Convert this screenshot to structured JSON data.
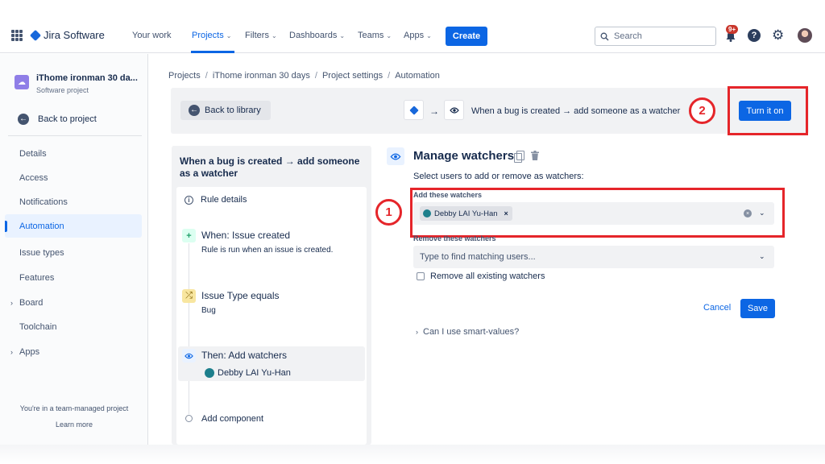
{
  "topnav": {
    "app_name": "Jira Software",
    "items": [
      {
        "label": "Your work"
      },
      {
        "label": "Projects"
      },
      {
        "label": "Filters"
      },
      {
        "label": "Dashboards"
      },
      {
        "label": "Teams"
      },
      {
        "label": "Apps"
      }
    ],
    "create_label": "Create",
    "search_placeholder": "Search",
    "notifications_badge": "9+",
    "help_glyph": "?",
    "icons": [
      "app-switcher-icon",
      "jira-logo-icon",
      "search-icon",
      "bell-icon",
      "help-icon",
      "gear-icon",
      "avatar"
    ]
  },
  "sidebar": {
    "project_name": "iThome ironman 30 da...",
    "project_type": "Software project",
    "back_label": "Back to project",
    "items": [
      {
        "label": "Details"
      },
      {
        "label": "Access"
      },
      {
        "label": "Notifications"
      },
      {
        "label": "Automation"
      },
      {
        "label": "Issue types"
      },
      {
        "label": "Features"
      },
      {
        "label": "Board"
      },
      {
        "label": "Toolchain"
      },
      {
        "label": "Apps"
      }
    ],
    "footer_text": "You're in a team-managed project",
    "learn_more": "Learn more"
  },
  "breadcrumb": [
    "Projects",
    "iThome ironman 30 days",
    "Project settings",
    "Automation"
  ],
  "header": {
    "back_label": "Back to library",
    "rule_summary": "When a bug is created → add someone as a watcher",
    "turn_on_label": "Turn it on"
  },
  "rule": {
    "title": "When a bug is created → add someone as a watcher",
    "details_label": "Rule details",
    "trigger_title": "When: Issue created",
    "trigger_sub": "Rule is run when an issue is created.",
    "condition_title": "Issue Type equals",
    "condition_sub": "Bug",
    "action_title": "Then: Add watchers",
    "action_user": "Debby LAI Yu-Han",
    "add_component": "Add component"
  },
  "config": {
    "title": "Manage watchers",
    "hint": "Select users to add or remove as watchers:",
    "add_label": "Add these watchers",
    "add_chip": "Debby LAI Yu-Han",
    "remove_label": "Remove these watchers",
    "remove_placeholder": "Type to find matching users...",
    "checkbox_label": "Remove all existing watchers",
    "cancel_label": "Cancel",
    "save_label": "Save",
    "smart_values": "Can I use smart-values?"
  },
  "annotations": {
    "one": "1",
    "two": "2",
    "color": "#e5252a"
  },
  "colors": {
    "accent": "#0c66e4",
    "text": "#172b4d"
  }
}
